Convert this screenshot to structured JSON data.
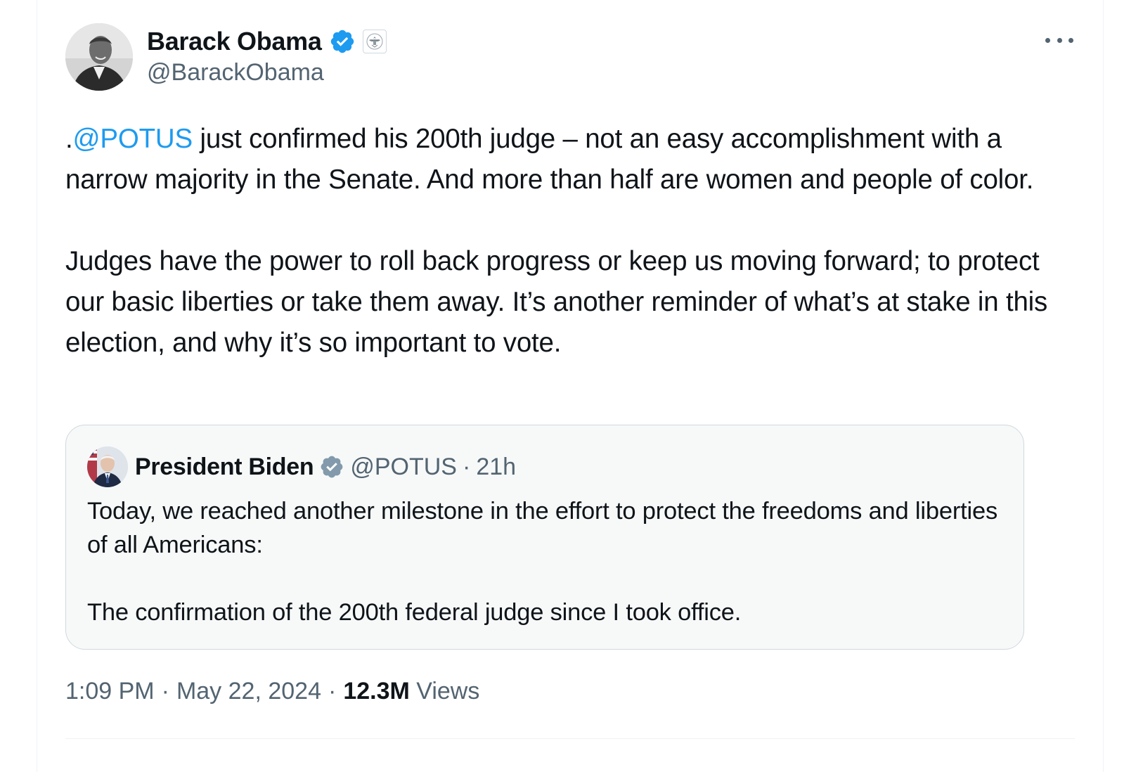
{
  "author": {
    "name": "Barack Obama",
    "handle": "@BarackObama",
    "verified_badge_icon": "verified-badge-icon",
    "affiliation_icon": "us-seal-icon",
    "more_icon": "more-options-icon"
  },
  "tweet": {
    "paragraph1_prefix": ".",
    "paragraph1_mention": "@POTUS",
    "paragraph1_rest": " just confirmed his 200th judge – not an easy accomplishment with a narrow majority in the Senate. And more than half are women and people of color.",
    "paragraph2": "Judges have the power to roll back progress or keep us moving forward; to protect our basic liberties or take them away. It’s another reminder of what’s at stake in this election, and why it’s so important to vote."
  },
  "quoted": {
    "name": "President Biden",
    "handle": "@POTUS",
    "separator": "·",
    "time": "21h",
    "badge_icon": "gray-verified-badge-icon",
    "paragraph1": "Today, we reached another milestone in the effort to protect the freedoms and liberties of all Americans:",
    "paragraph2": "The confirmation of the 200th federal judge since I took office."
  },
  "meta": {
    "time": "1:09 PM",
    "sep1": "·",
    "date": "May 22, 2024",
    "sep2": "·",
    "views_count": "12.3M",
    "views_label": "Views"
  },
  "colors": {
    "link": "#1d9bf0",
    "secondary_text": "#536471",
    "primary_text": "#0f1419",
    "quote_bg": "#f7f9f9",
    "border": "#cfd9de"
  }
}
